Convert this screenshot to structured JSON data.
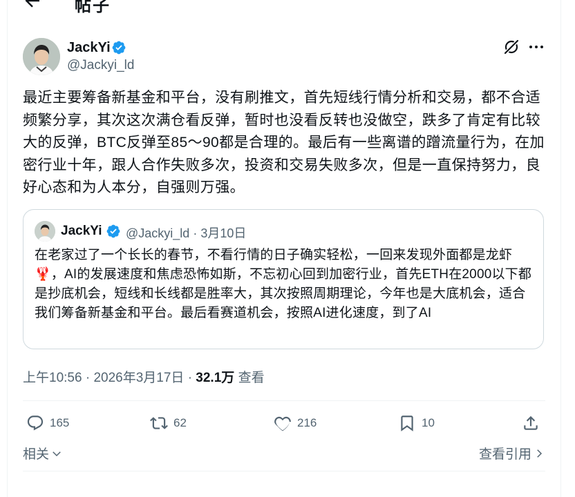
{
  "header": {
    "title": "帖子",
    "back_icon": "arrow-left-icon"
  },
  "author": {
    "name": "JackYi",
    "handle": "@Jackyi_ld",
    "verified_color": "#1d9bf0"
  },
  "post": {
    "text": "最近主要筹备新基金和平台，没有刷推文，首先短线行情分析和交易，都不合适频繁分享，其次这次满仓看反弹，暂时也没看反转也没做空，跌多了肯定有比较大的反弹，BTC反弹至85～90都是合理的。最后有一些离谱的蹭流量行为，在加密行业十年，跟人合作失败多次，投资和交易失败多次，但是一直保持努力，良好心态和为人本分，自强则万强。",
    "time": "上午10:56",
    "date": "2026年3月17日",
    "separator": "·",
    "views_count": "32.1万",
    "views_label": "查看"
  },
  "quote": {
    "name": "JackYi",
    "handle": "@Jackyi_ld",
    "separator": "·",
    "date": "3月10日",
    "text": "在老家过了一个长长的春节，不看行情的日子确实轻松，一回来发现外面都是龙虾🦞，AI的发展速度和焦虑恐怖如斯，不忘初心回到加密行业，首先ETH在2000以下都是抄底机会，短线和长线都是胜率大，其次按照周期理论，今年也是大底机会，适合我们筹备新基金和平台。最后看赛道机会，按照AI进化速度，到了AI"
  },
  "actions": {
    "replies": "165",
    "reposts": "62",
    "likes": "216",
    "bookmarks": "10"
  },
  "footer": {
    "related_label": "相关",
    "view_quotes_label": "查看引用"
  }
}
